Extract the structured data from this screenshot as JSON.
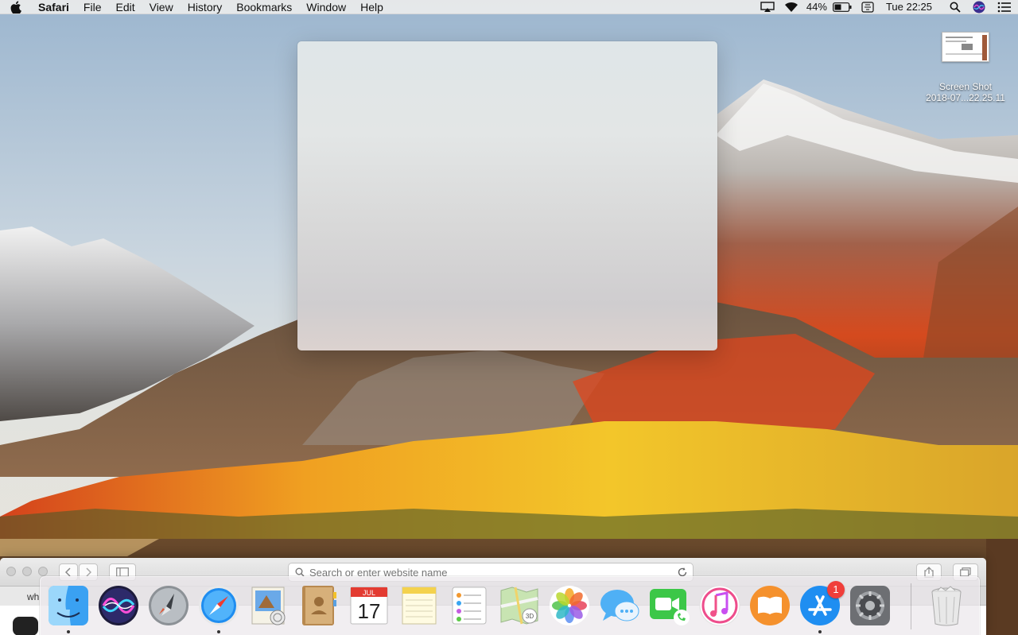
{
  "menubar": {
    "app_name": "Safari",
    "menus": [
      "File",
      "Edit",
      "View",
      "History",
      "Bookmarks",
      "Window",
      "Help"
    ],
    "battery_percent": "44%",
    "clock": "Tue 22:25"
  },
  "desktop": {
    "file_label_line1": "Screen Shot",
    "file_label_line2": "2018-07...22.25.11"
  },
  "safari": {
    "url_placeholder": "Search or enter website name",
    "tab_label": "wh"
  },
  "dock": {
    "items": [
      {
        "name": "Finder",
        "icon": "finder-icon",
        "running": true
      },
      {
        "name": "Siri",
        "icon": "siri-icon",
        "running": false
      },
      {
        "name": "Launchpad",
        "icon": "launchpad-icon",
        "running": false
      },
      {
        "name": "Safari",
        "icon": "safari-icon",
        "running": true
      },
      {
        "name": "Mail",
        "icon": "mail-icon",
        "running": false
      },
      {
        "name": "Contacts",
        "icon": "contacts-icon",
        "running": false
      },
      {
        "name": "Calendar",
        "icon": "calendar-icon",
        "running": false,
        "month": "JUL",
        "day": "17"
      },
      {
        "name": "Notes",
        "icon": "notes-icon",
        "running": false
      },
      {
        "name": "Reminders",
        "icon": "reminders-icon",
        "running": false
      },
      {
        "name": "Maps",
        "icon": "maps-icon",
        "running": false,
        "label": "3D"
      },
      {
        "name": "Photos",
        "icon": "photos-icon",
        "running": false
      },
      {
        "name": "Messages",
        "icon": "messages-icon",
        "running": false
      },
      {
        "name": "FaceTime",
        "icon": "facetime-icon",
        "running": false
      },
      {
        "name": "iTunes",
        "icon": "itunes-icon",
        "running": false
      },
      {
        "name": "iBooks",
        "icon": "ibooks-icon",
        "running": false
      },
      {
        "name": "App Store",
        "icon": "app-store-icon",
        "running": true,
        "badge": "1"
      },
      {
        "name": "System Preferences",
        "icon": "system-preferences-icon",
        "running": false
      },
      {
        "name": "Trash",
        "icon": "trash-icon",
        "running": false
      }
    ]
  },
  "colors": {
    "badge": "#f03e3a",
    "menubar": "#ececec"
  }
}
